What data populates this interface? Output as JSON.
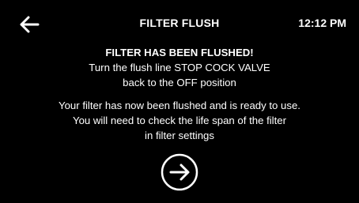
{
  "header": {
    "title": "FILTER FLUSH",
    "time": "12:12 PM",
    "back_icon": "arrow-left-icon"
  },
  "message": {
    "heading": "FILTER HAS BEEN FLUSHED!",
    "instruction_line1": "Turn the flush line STOP COCK VALVE",
    "instruction_line2": "back to the OFF position",
    "info_line1": "Your filter has now been flushed and is ready to use.",
    "info_line2": "You will need to check the life span of the filter",
    "info_line3": "in filter settings"
  },
  "next_button": {
    "icon": "arrow-right-circle-icon"
  },
  "colors": {
    "background": "#000000",
    "foreground": "#ffffff"
  }
}
